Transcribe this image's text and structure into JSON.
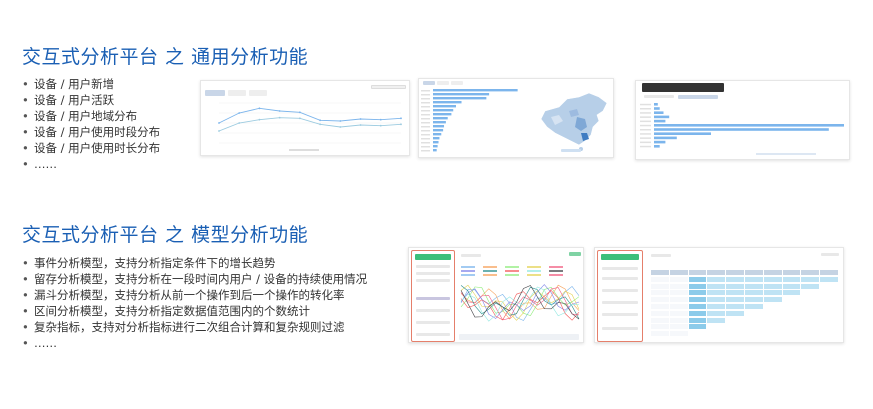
{
  "sections": [
    {
      "title": "交互式分析平台 之 通用分析功能",
      "bullets": [
        "设备 / 用户新增",
        "设备 / 用户活跃",
        "设备 / 用户地域分布",
        "设备 / 用户使用时段分布",
        "设备 / 用户使用时长分布",
        "……"
      ]
    },
    {
      "title": "交互式分析平台 之 模型分析功能",
      "bullets": [
        "事件分析模型，支持分析指定条件下的增长趋势",
        "留存分析模型，支持分析在一段时间内用户 / 设备的持续使用情况",
        "漏斗分析模型，支持分析从前一个操作到后一个操作的转化率",
        "区间分析模型，支持分析指定数据值范围内的个数统计",
        "复杂指标，支持对分析指标进行二次组合计算和复杂规则过滤",
        "……"
      ]
    }
  ],
  "colors": {
    "title_blue": "#1a5fb4",
    "chart_blue": "#7cb5ec",
    "panel_red": "#e57f6b",
    "button_green": "#3cbf7a"
  },
  "thumbnails": {
    "line_chart": {
      "series": [
        {
          "values": [
            30,
            45,
            52,
            48,
            46,
            34,
            33,
            36,
            35,
            37
          ]
        },
        {
          "values": [
            18,
            30,
            35,
            38,
            37,
            28,
            24,
            27,
            26,
            28
          ]
        }
      ]
    },
    "bar_map": {
      "bars": [
        92,
        61,
        58,
        31,
        25,
        22,
        20,
        16,
        14,
        12,
        11,
        9,
        7,
        6,
        5,
        4
      ]
    },
    "duration_bars": {
      "bars": [
        2,
        3,
        5,
        8,
        6,
        100,
        92,
        30,
        12,
        6,
        3
      ]
    }
  }
}
